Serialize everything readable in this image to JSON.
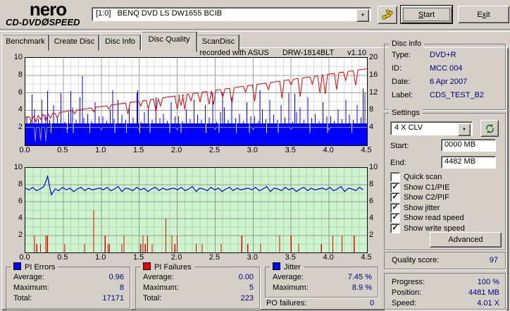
{
  "logo": {
    "name": "nero",
    "product_a": "CD-DVD",
    "disc_glyph": "Ø",
    "product_b": "SPEED"
  },
  "toolbar": {
    "drive": "[1:0]   BENQ DVD LS DW1655 BCIB",
    "start_u": "S",
    "start_rest": "tart",
    "exit_pre": "E",
    "exit_u": "x",
    "exit_rest": "it",
    "options_icon": "tools"
  },
  "tabs": [
    {
      "label": "Benchmark"
    },
    {
      "label": "Create Disc"
    },
    {
      "label": "Disc Info"
    },
    {
      "label": "Disc Quality"
    },
    {
      "label": "ScanDisc"
    }
  ],
  "active_tab": "Disc Quality",
  "chart_header": {
    "recorded": "recorded with ASUS",
    "drive": "DRW-1814BLT",
    "version": "v1.10"
  },
  "disc_info": {
    "title": "Disc info",
    "rows": [
      {
        "label": "Type:",
        "value": "DVD+R"
      },
      {
        "label": "ID:",
        "value": "MCC 004"
      },
      {
        "label": "Date:",
        "value": "6 Apr 2007"
      },
      {
        "label": "Label:",
        "value": "CDS_TEST_B2"
      }
    ]
  },
  "settings": {
    "title": "Settings",
    "speed_selected": "4 X CLV",
    "start_label": "Start:",
    "start_value": "0000 MB",
    "end_label": "End:",
    "end_value": "4482 MB",
    "checkboxes": [
      {
        "label": "Quick scan",
        "checked": false
      },
      {
        "label": "Show C1/PIE",
        "checked": true
      },
      {
        "label": "Show C2/PIF",
        "checked": true
      },
      {
        "label": "Show jitter",
        "checked": true
      },
      {
        "label": "Show read speed",
        "checked": true
      },
      {
        "label": "Show write speed",
        "checked": true
      }
    ],
    "advanced_label": "Advanced"
  },
  "quality": {
    "label": "Quality score:",
    "value": "97"
  },
  "progress": {
    "rows": [
      {
        "label": "Progress:",
        "value": "100 %"
      },
      {
        "label": "Position:",
        "value": "4481 MB"
      },
      {
        "label": "Speed:",
        "value": "4.01 X"
      }
    ]
  },
  "stats": {
    "pi_errors": {
      "title": "PI Errors",
      "color": "#0000ff",
      "rows": [
        {
          "label": "Average:",
          "value": "0.96"
        },
        {
          "label": "Maximum:",
          "value": "8"
        },
        {
          "label": "Total:",
          "value": "17171"
        }
      ]
    },
    "pi_failures": {
      "title": "PI Failures",
      "color": "#e60000",
      "rows": [
        {
          "label": "Average:",
          "value": "0.00"
        },
        {
          "label": "Maximum:",
          "value": "5"
        },
        {
          "label": "Total:",
          "value": "223"
        }
      ]
    },
    "jitter": {
      "title": "Jitter",
      "color": "#0000ff",
      "rows": [
        {
          "label": "Average:",
          "value": "7.45 %"
        },
        {
          "label": "Maximum:",
          "value": "8.9 %"
        }
      ]
    },
    "po_failures": {
      "label": "PO failures:",
      "value": "0"
    }
  },
  "chart_data": [
    {
      "type": "bar+line",
      "name": "pi-errors-and-speed",
      "title": "",
      "x_range": [
        0,
        4.5
      ],
      "y_left_range": [
        0,
        10
      ],
      "y_right_range": [
        0,
        20
      ],
      "x_ticks": [
        "0.0",
        "0.5",
        "1.0",
        "1.5",
        "2.0",
        "2.5",
        "3.0",
        "3.5",
        "4.0",
        "4.5"
      ],
      "left_ticks": [
        "10",
        "8",
        "6",
        "4",
        "2"
      ],
      "right_ticks": [
        "20",
        "16",
        "12",
        "8",
        "4"
      ],
      "colors": {
        "pi_errors": "#0000ff",
        "write_speed": "#e60000",
        "read_speed": "#9a9a9a",
        "grid_light": "#dcdcdc",
        "grid_dark": "#a0a0a0"
      },
      "base_band_top": 2.5,
      "band_gaps": [
        0.34,
        0.55,
        0.63,
        0.85,
        1.02,
        1.18,
        1.33,
        1.51,
        1.64,
        1.9,
        2.05,
        2.22,
        2.38,
        2.55,
        2.78,
        2.95,
        3.18,
        3.33,
        3.52,
        3.75,
        3.98,
        4.12,
        4.3
      ],
      "bars": [
        [
          0.02,
          3.3
        ],
        [
          0.07,
          2.8
        ],
        [
          0.12,
          4.1
        ],
        [
          0.17,
          3.0
        ],
        [
          0.22,
          5.2
        ],
        [
          0.27,
          3.5
        ],
        [
          0.32,
          2.9
        ],
        [
          0.37,
          4.6
        ],
        [
          0.42,
          3.2
        ],
        [
          0.47,
          6.0
        ],
        [
          0.52,
          2.7
        ],
        [
          0.57,
          3.8
        ],
        [
          0.62,
          4.3
        ],
        [
          0.67,
          2.9
        ],
        [
          0.72,
          5.5
        ],
        [
          0.77,
          3.1
        ],
        [
          0.82,
          3.6
        ],
        [
          0.87,
          2.8
        ],
        [
          0.92,
          4.9
        ],
        [
          0.97,
          3.3
        ],
        [
          1.02,
          3.3
        ],
        [
          1.07,
          2.8
        ],
        [
          1.12,
          4.1
        ],
        [
          1.17,
          3.0
        ],
        [
          1.22,
          5.2
        ],
        [
          1.27,
          3.5
        ],
        [
          1.32,
          2.9
        ],
        [
          1.37,
          4.6
        ],
        [
          1.42,
          3.2
        ],
        [
          1.47,
          6.0
        ],
        [
          1.52,
          2.7
        ],
        [
          1.57,
          3.8
        ],
        [
          1.62,
          4.3
        ],
        [
          1.67,
          2.9
        ],
        [
          1.72,
          5.5
        ],
        [
          1.77,
          3.1
        ],
        [
          1.82,
          3.6
        ],
        [
          1.87,
          2.8
        ],
        [
          1.92,
          4.9
        ],
        [
          1.97,
          3.3
        ],
        [
          2.02,
          3.3
        ],
        [
          2.07,
          2.8
        ],
        [
          2.12,
          4.1
        ],
        [
          2.17,
          3.0
        ],
        [
          2.22,
          5.2
        ],
        [
          2.27,
          3.5
        ],
        [
          2.32,
          2.9
        ],
        [
          2.37,
          4.6
        ],
        [
          2.42,
          3.2
        ],
        [
          2.47,
          6.0
        ],
        [
          2.52,
          2.7
        ],
        [
          2.57,
          3.8
        ],
        [
          2.62,
          4.3
        ],
        [
          2.67,
          2.9
        ],
        [
          2.72,
          5.5
        ],
        [
          2.77,
          3.1
        ],
        [
          2.82,
          3.6
        ],
        [
          2.87,
          2.8
        ],
        [
          2.92,
          4.9
        ],
        [
          2.97,
          3.3
        ],
        [
          3.02,
          3.3
        ],
        [
          3.07,
          2.8
        ],
        [
          3.12,
          4.1
        ],
        [
          3.17,
          3.0
        ],
        [
          3.22,
          5.2
        ],
        [
          3.27,
          3.5
        ],
        [
          3.32,
          2.9
        ],
        [
          3.37,
          4.6
        ],
        [
          3.42,
          3.2
        ],
        [
          3.47,
          6.0
        ],
        [
          3.52,
          2.7
        ],
        [
          3.57,
          3.8
        ],
        [
          3.62,
          4.3
        ],
        [
          3.67,
          2.9
        ],
        [
          3.72,
          5.5
        ],
        [
          3.77,
          3.1
        ],
        [
          3.82,
          3.6
        ],
        [
          3.87,
          2.8
        ],
        [
          3.92,
          4.9
        ],
        [
          3.97,
          3.3
        ],
        [
          4.02,
          3.3
        ],
        [
          4.07,
          2.8
        ],
        [
          4.12,
          4.1
        ],
        [
          4.17,
          3.0
        ],
        [
          4.22,
          5.2
        ],
        [
          4.27,
          3.5
        ],
        [
          4.32,
          2.9
        ],
        [
          4.37,
          4.6
        ],
        [
          4.42,
          3.2
        ],
        [
          4.47,
          6.0
        ],
        [
          0.75,
          7.9
        ],
        [
          0.29,
          6.2
        ],
        [
          1.48,
          6.3
        ],
        [
          2.6,
          6.1
        ],
        [
          3.09,
          6.3
        ],
        [
          4.45,
          6.5
        ],
        [
          0.09,
          5.8
        ],
        [
          0.6,
          6.2
        ],
        [
          1.15,
          6.3
        ],
        [
          3.55,
          5.9
        ]
      ],
      "read_speed": {
        "level": 2.05,
        "dips": [
          [
            0.13,
            1.6
          ],
          [
            0.2,
            1.5
          ],
          [
            0.27,
            1.6
          ],
          [
            0.55,
            0.3
          ],
          [
            1.0,
            0.3
          ],
          [
            1.5,
            0.25
          ],
          [
            2.0,
            0.3
          ],
          [
            2.5,
            0.25
          ],
          [
            3.0,
            0.3
          ],
          [
            3.5,
            0.25
          ],
          [
            4.0,
            0.3
          ]
        ]
      },
      "write_speed": {
        "start_y": 3.2,
        "end_y": 8.75,
        "dips": [
          [
            0.08,
            0.5
          ],
          [
            0.14,
            0.7
          ],
          [
            0.2,
            0.5
          ],
          [
            0.27,
            0.8
          ],
          [
            0.33,
            0.5
          ],
          [
            0.42,
            0.6
          ],
          [
            0.65,
            0.4
          ],
          [
            0.9,
            0.5
          ],
          [
            1.1,
            0.4
          ],
          [
            1.35,
            1.3
          ],
          [
            1.52,
            0.6
          ],
          [
            1.62,
            1.0
          ],
          [
            1.72,
            1.5
          ],
          [
            1.78,
            0.9
          ],
          [
            2.0,
            1.6
          ],
          [
            2.05,
            1.2
          ],
          [
            2.1,
            1.7
          ],
          [
            2.18,
            0.8
          ],
          [
            2.3,
            1.1
          ],
          [
            2.42,
            1.5
          ],
          [
            2.48,
            1.6
          ],
          [
            2.6,
            0.9
          ],
          [
            2.72,
            1.8
          ],
          [
            2.9,
            0.7
          ],
          [
            3.02,
            1.9
          ],
          [
            3.2,
            0.8
          ],
          [
            3.38,
            2.0
          ],
          [
            3.5,
            0.6
          ],
          [
            3.62,
            2.1
          ],
          [
            3.78,
            0.9
          ],
          [
            3.88,
            2.0
          ],
          [
            3.95,
            2.2
          ],
          [
            4.1,
            1.9
          ],
          [
            4.22,
            1.0
          ],
          [
            4.35,
            1.7
          ]
        ]
      }
    },
    {
      "type": "line+bar",
      "name": "jitter-and-pi-failures",
      "x_range": [
        0,
        4.5
      ],
      "y_range": [
        0,
        10
      ],
      "x_ticks": [
        "0.0",
        "0.5",
        "1.0",
        "1.5",
        "2.0",
        "2.5",
        "3.0",
        "3.5",
        "4.0",
        "4.5"
      ],
      "left_ticks": [
        "10",
        "8",
        "6",
        "4",
        "2"
      ],
      "right_ticks": [
        "10",
        "8",
        "6",
        "4",
        "2"
      ],
      "colors": {
        "bg": "#cdf5cd",
        "jitter": "#0000e0",
        "failures": "#e60000",
        "grid_light": "#b7ceb7",
        "grid_dark": "#969696"
      },
      "jitter_points": [
        7.6,
        7.4,
        7.7,
        7.3,
        7.5,
        7.8,
        9.0,
        6.8,
        7.5,
        7.3,
        7.7,
        7.4,
        7.6,
        7.2,
        7.5,
        7.7,
        7.3,
        7.6,
        7.4,
        7.5,
        7.6,
        7.4,
        7.7,
        7.3,
        7.5,
        7.8,
        7.2,
        7.6,
        7.5,
        7.3,
        7.7,
        7.4,
        7.6,
        7.2,
        7.5,
        7.7,
        7.3,
        7.6,
        7.4,
        7.5,
        7.6,
        7.4,
        7.7,
        7.3,
        7.5,
        7.8,
        7.2,
        7.6,
        7.5,
        7.3,
        7.7,
        7.4,
        7.6,
        7.2,
        7.5,
        7.7,
        7.3,
        7.6,
        7.4,
        7.5,
        7.6,
        7.4,
        7.7,
        7.3,
        7.5,
        7.8,
        7.2,
        7.6,
        7.5,
        7.3,
        7.7,
        7.4,
        7.6,
        7.2,
        7.5,
        7.7,
        7.3,
        7.6,
        7.4,
        7.5,
        7.6,
        7.4,
        7.7,
        7.3,
        7.5,
        7.8,
        7.2,
        7.6,
        7.5,
        7.3,
        7.7,
        7.4
      ],
      "failures": [
        [
          0.12,
          2
        ],
        [
          0.15,
          1
        ],
        [
          0.2,
          1
        ],
        [
          0.27,
          2
        ],
        [
          0.29,
          2
        ],
        [
          0.52,
          1
        ],
        [
          0.78,
          1
        ],
        [
          0.9,
          5
        ],
        [
          1.05,
          2
        ],
        [
          1.09,
          1
        ],
        [
          1.11,
          1
        ],
        [
          1.27,
          1
        ],
        [
          1.3,
          2
        ],
        [
          1.52,
          1
        ],
        [
          1.55,
          2
        ],
        [
          1.58,
          1
        ],
        [
          1.61,
          2
        ],
        [
          1.67,
          1
        ],
        [
          1.85,
          4
        ],
        [
          1.93,
          2
        ],
        [
          1.97,
          1
        ],
        [
          2.0,
          2
        ],
        [
          2.25,
          1
        ],
        [
          2.33,
          1
        ],
        [
          2.58,
          1
        ],
        [
          2.85,
          2
        ],
        [
          2.93,
          1
        ],
        [
          3.1,
          1
        ],
        [
          3.35,
          2
        ],
        [
          3.5,
          2
        ],
        [
          3.6,
          1
        ],
        [
          3.9,
          1
        ],
        [
          4.05,
          2
        ],
        [
          4.17,
          2
        ],
        [
          4.33,
          2
        ]
      ]
    }
  ]
}
